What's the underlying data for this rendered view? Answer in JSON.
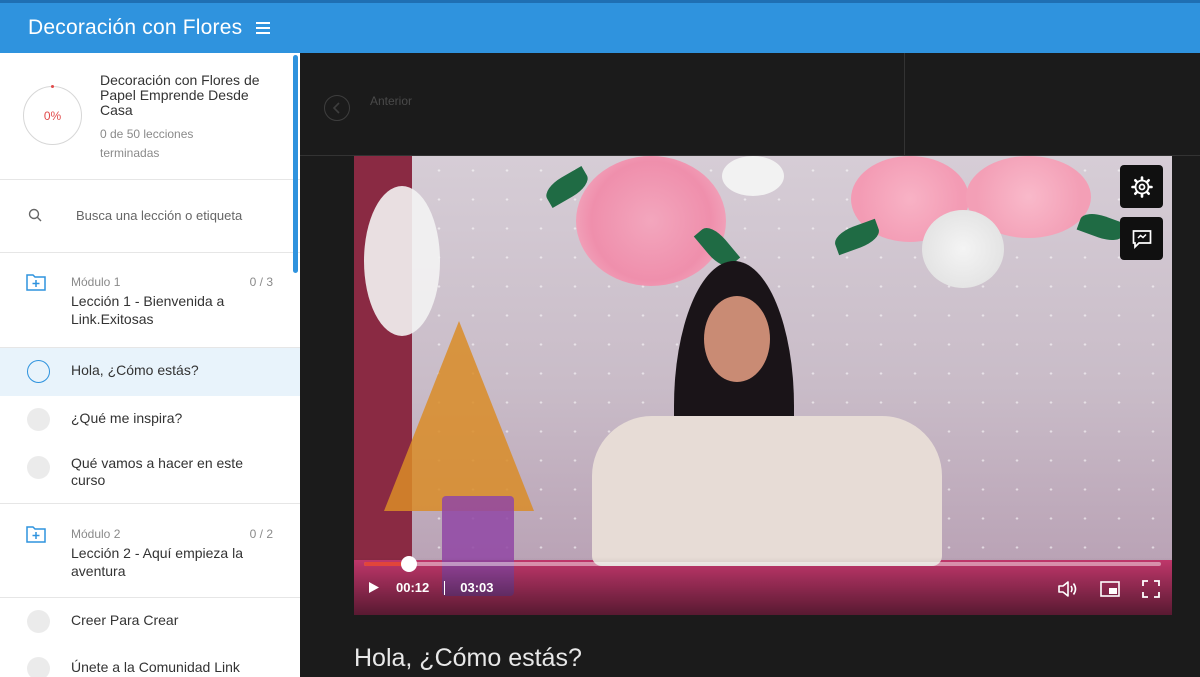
{
  "header": {
    "title": "Decoración con Flores"
  },
  "course": {
    "progress": "0%",
    "progress_fraction": 0.0,
    "name": "Decoración con Flores de Papel Emprende Desde Casa",
    "completed": "0 de 50 lecciones terminadas"
  },
  "search": {
    "placeholder": "Busca una lección o etiqueta"
  },
  "modules": [
    {
      "label": "Módulo 1",
      "count": "0 / 3",
      "title": "Lección 1 - Bienvenida a Link.Exitosas",
      "lessons": [
        "Hola, ¿Cómo estás?",
        "¿Qué me inspira?",
        "Qué vamos a hacer en este curso"
      ]
    },
    {
      "label": "Módulo 2",
      "count": "0 / 2",
      "title": "Lección 2 - Aquí empieza la aventura",
      "lessons": [
        "Creer Para Crear",
        "Únete a la Comunidad Link"
      ]
    }
  ],
  "nav": {
    "prev_label": "Anterior"
  },
  "player": {
    "current_time": "00:12",
    "duration": "03:03",
    "progress_fraction": 0.057
  },
  "lesson_title": "Hola, ¿Cómo estás?",
  "colors": {
    "brand_blue": "#2f93de",
    "progress_red": "#e2453a",
    "active_row": "#e8f3fb"
  }
}
